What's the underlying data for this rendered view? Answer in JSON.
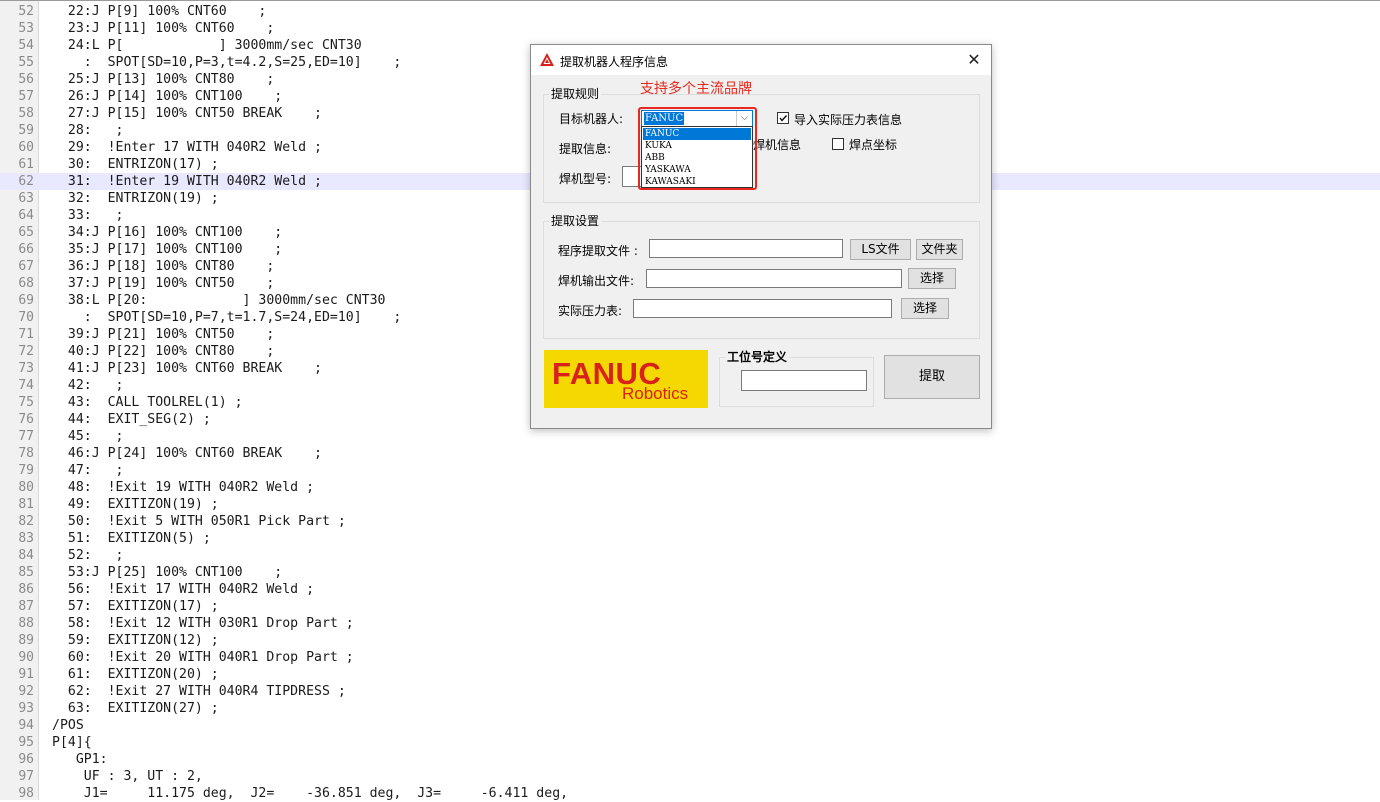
{
  "editor": {
    "highlight_line": 62,
    "lines": [
      {
        "n": "52",
        "t": "  22:J P[9] 100% CNT60    ;"
      },
      {
        "n": "53",
        "t": "  23:J P[11] 100% CNT60    ;"
      },
      {
        "n": "54",
        "t": "  24:L P[            ] 3000mm/sec CNT30"
      },
      {
        "n": "55",
        "t": "    :  SPOT[SD=10,P=3,t=4.2,S=25,ED=10]    ;"
      },
      {
        "n": "56",
        "t": "  25:J P[13] 100% CNT80    ;"
      },
      {
        "n": "57",
        "t": "  26:J P[14] 100% CNT100    ;"
      },
      {
        "n": "58",
        "t": "  27:J P[15] 100% CNT50 BREAK    ;"
      },
      {
        "n": "59",
        "t": "  28:   ;"
      },
      {
        "n": "60",
        "t": "  29:  !Enter 17 WITH 040R2 Weld ;"
      },
      {
        "n": "61",
        "t": "  30:  ENTRIZON(17) ;"
      },
      {
        "n": "62",
        "t": "  31:  !Enter 19 WITH 040R2 Weld ;"
      },
      {
        "n": "63",
        "t": "  32:  ENTRIZON(19) ;"
      },
      {
        "n": "64",
        "t": "  33:   ;"
      },
      {
        "n": "65",
        "t": "  34:J P[16] 100% CNT100    ;"
      },
      {
        "n": "66",
        "t": "  35:J P[17] 100% CNT100    ;"
      },
      {
        "n": "67",
        "t": "  36:J P[18] 100% CNT80    ;"
      },
      {
        "n": "68",
        "t": "  37:J P[19] 100% CNT50    ;"
      },
      {
        "n": "69",
        "t": "  38:L P[20:            ] 3000mm/sec CNT30"
      },
      {
        "n": "70",
        "t": "    :  SPOT[SD=10,P=7,t=1.7,S=24,ED=10]    ;"
      },
      {
        "n": "71",
        "t": "  39:J P[21] 100% CNT50    ;"
      },
      {
        "n": "72",
        "t": "  40:J P[22] 100% CNT80    ;"
      },
      {
        "n": "73",
        "t": "  41:J P[23] 100% CNT60 BREAK    ;"
      },
      {
        "n": "74",
        "t": "  42:   ;"
      },
      {
        "n": "75",
        "t": "  43:  CALL TOOLREL(1) ;"
      },
      {
        "n": "76",
        "t": "  44:  EXIT_SEG(2) ;"
      },
      {
        "n": "77",
        "t": "  45:   ;"
      },
      {
        "n": "78",
        "t": "  46:J P[24] 100% CNT60 BREAK    ;"
      },
      {
        "n": "79",
        "t": "  47:   ;"
      },
      {
        "n": "80",
        "t": "  48:  !Exit 19 WITH 040R2 Weld ;"
      },
      {
        "n": "81",
        "t": "  49:  EXITIZON(19) ;"
      },
      {
        "n": "82",
        "t": "  50:  !Exit 5 WITH 050R1 Pick Part ;"
      },
      {
        "n": "83",
        "t": "  51:  EXITIZON(5) ;"
      },
      {
        "n": "84",
        "t": "  52:   ;"
      },
      {
        "n": "85",
        "t": "  53:J P[25] 100% CNT100    ;"
      },
      {
        "n": "86",
        "t": "  56:  !Exit 17 WITH 040R2 Weld ;"
      },
      {
        "n": "87",
        "t": "  57:  EXITIZON(17) ;"
      },
      {
        "n": "88",
        "t": "  58:  !Exit 12 WITH 030R1 Drop Part ;"
      },
      {
        "n": "89",
        "t": "  59:  EXITIZON(12) ;"
      },
      {
        "n": "90",
        "t": "  60:  !Exit 20 WITH 040R1 Drop Part ;"
      },
      {
        "n": "91",
        "t": "  61:  EXITIZON(20) ;"
      },
      {
        "n": "92",
        "t": "  62:  !Exit 27 WITH 040R4 TIPDRESS ;"
      },
      {
        "n": "93",
        "t": "  63:  EXITIZON(27) ;"
      },
      {
        "n": "94",
        "t": "/POS"
      },
      {
        "n": "95",
        "t": "P[4]{"
      },
      {
        "n": "96",
        "t": "   GP1:"
      },
      {
        "n": "97",
        "t": "    UF : 3, UT : 2,"
      },
      {
        "n": "98",
        "t": "    J1=     11.175 deg,  J2=    -36.851 deg,  J3=     -6.411 deg,"
      }
    ]
  },
  "dialog": {
    "title": "提取机器人程序信息",
    "close_glyph": "✕",
    "annotation": "支持多个主流品牌",
    "rules": {
      "group_label": "提取规则",
      "target_label": "目标机器人:",
      "selected_brand": "FANUC",
      "brand_options": [
        "FANUC",
        "KUKA",
        "ABB",
        "YASKAWA",
        "KAWASAKI"
      ],
      "import_pressure_label": "导入实际压力表信息",
      "import_pressure_checked": true,
      "extract_info_label": "提取信息:",
      "welder_info_label": "焊机信息",
      "welder_info_checked": false,
      "weld_coord_label": "焊点坐标",
      "weld_coord_checked": false,
      "welder_model_label": "焊机型号:",
      "welder_model_value": ""
    },
    "settings": {
      "group_label": "提取设置",
      "program_file_label": "程序提取文件 :",
      "program_file_value": "",
      "ls_file_button": "LS文件",
      "folder_button": "文件夹",
      "welder_output_label": "焊机输出文件:",
      "welder_output_value": "",
      "select_button_1": "选择",
      "pressure_table_label": "实际压力表:",
      "pressure_table_value": "",
      "select_button_2": "选择"
    },
    "logo": {
      "word": "FANUC",
      "sub": "Robotics"
    },
    "station": {
      "group_label": "工位号定义",
      "value": ""
    },
    "extract_button": "提取"
  }
}
